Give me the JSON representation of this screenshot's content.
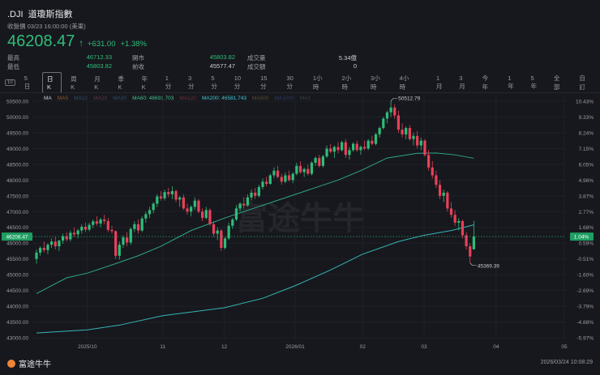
{
  "header": {
    "symbol": ".DJI",
    "name": "道瓊斯指數",
    "close_label": "收盤價 03/23 16:00:00 (美東)",
    "price": "46208.47",
    "change": "+631.00",
    "change_pct": "+1.38%"
  },
  "stats": [
    {
      "label": "最高",
      "value": "46712.33",
      "color": "green"
    },
    {
      "label": "開市",
      "value": "45803.82",
      "color": "green"
    },
    {
      "label": "成交量",
      "value": "5.34億",
      "color": "white"
    },
    {
      "label": "最低",
      "value": "45803.82",
      "color": "green"
    },
    {
      "label": "前收",
      "value": "45577.47",
      "color": "white"
    },
    {
      "label": "成交額",
      "value": "0",
      "color": "white"
    }
  ],
  "timeframes": [
    "5日",
    "日K",
    "周K",
    "月K",
    "季K",
    "年K",
    "1分",
    "3分",
    "5分",
    "10分",
    "15分",
    "30分",
    "1小時",
    "2小時",
    "3小時",
    "4小時"
  ],
  "ranges": [
    "1月",
    "3月",
    "今年",
    "1年",
    "5年",
    "全部",
    "自訂"
  ],
  "selected_timeframe": "日K",
  "legend": [
    {
      "label": "MA",
      "color": "#c9cbd1"
    },
    {
      "label": "MA5",
      "color": "#8a5a2e"
    },
    {
      "label": "MA10",
      "color": "#2d4f6e"
    },
    {
      "label": "MA20",
      "color": "#5a3548"
    },
    {
      "label": "MA30",
      "color": "#2d4c6a"
    },
    {
      "label": "MA60: 48691.703",
      "color": "#3fc08f"
    },
    {
      "label": "MA120",
      "color": "#6a2e3c"
    },
    {
      "label": "MA200: 46581.743",
      "color": "#3ec9d6"
    },
    {
      "label": "MA500",
      "color": "#5a4a2e"
    },
    {
      "label": "MA1000",
      "color": "#2e3a6a"
    },
    {
      "label": "MA1",
      "color": "#3a3d44"
    }
  ],
  "watermark": "富途牛牛",
  "footer": {
    "brand": "富途牛牛",
    "timestamp": "2026/03/24 10:08:29"
  },
  "colors": {
    "up": "#2ebd7a",
    "down": "#e8415a",
    "bg": "#17181d",
    "ma60": "#2fa58a",
    "ma200": "#35b5b5"
  },
  "chart_data": {
    "type": "candlestick",
    "ylim": [
      43000,
      50500
    ],
    "yticks": [
      "50500.00",
      "50000.00",
      "49500.00",
      "49000.00",
      "48500.00",
      "48000.00",
      "47500.00",
      "47000.00",
      "46500.00",
      "46000.00",
      "45500.00",
      "45000.00",
      "44500.00",
      "44000.00",
      "43500.00",
      "43000.00"
    ],
    "pct_ticks": [
      "10.43%",
      "9.33%",
      "8.24%",
      "7.15%",
      "6.05%",
      "4.96%",
      "3.87%",
      "2.77%",
      "1.68%",
      "0.59%",
      "-0.51%",
      "-1.60%",
      "-2.69%",
      "-3.79%",
      "-4.88%",
      "-5.97%"
    ],
    "xticks": [
      {
        "label": "2025/10",
        "index": 13.5
      },
      {
        "label": "11",
        "index": 33.5
      },
      {
        "label": "12",
        "index": 49.8
      },
      {
        "label": "2026/01",
        "index": 68.6
      },
      {
        "label": "02",
        "index": 86.5
      },
      {
        "label": "03",
        "index": 102.8
      },
      {
        "label": "04",
        "index": 121.9
      },
      {
        "label": "05",
        "index": 140
      }
    ],
    "last_price_label": "46208.47",
    "last_pct_label": "1.04%",
    "high_marker": {
      "label": "50512.79",
      "index": 94,
      "value": 50512.79
    },
    "low_marker": {
      "label": "45369.39",
      "index": 115,
      "value": 45369.39
    },
    "candles": [
      [
        45500,
        45800,
        45350,
        45700
      ],
      [
        45700,
        45900,
        45600,
        45850
      ],
      [
        45850,
        46050,
        45700,
        45780
      ],
      [
        45780,
        46000,
        45650,
        45950
      ],
      [
        45950,
        46150,
        45850,
        46050
      ],
      [
        46050,
        46200,
        45800,
        45900
      ],
      [
        45900,
        46100,
        45750,
        46080
      ],
      [
        46080,
        46300,
        45980,
        46220
      ],
      [
        46220,
        46350,
        46050,
        46120
      ],
      [
        46120,
        46400,
        46050,
        46330
      ],
      [
        46330,
        46500,
        46200,
        46280
      ],
      [
        46280,
        46450,
        46150,
        46400
      ],
      [
        46400,
        46600,
        46300,
        46520
      ],
      [
        46520,
        46650,
        46350,
        46430
      ],
      [
        46430,
        46650,
        46380,
        46580
      ],
      [
        46580,
        46750,
        46480,
        46690
      ],
      [
        46690,
        46850,
        46550,
        46620
      ],
      [
        46620,
        46800,
        46500,
        46750
      ],
      [
        46750,
        46900,
        46600,
        46700
      ],
      [
        46700,
        46800,
        46350,
        46420
      ],
      [
        46420,
        46550,
        46300,
        46380
      ],
      [
        46380,
        46400,
        45500,
        45600
      ],
      [
        45600,
        46050,
        45480,
        45950
      ],
      [
        45950,
        46250,
        45850,
        46180
      ],
      [
        46180,
        46350,
        45900,
        46020
      ],
      [
        46020,
        46500,
        45950,
        46450
      ],
      [
        46450,
        46700,
        46350,
        46600
      ],
      [
        46600,
        46750,
        46300,
        46400
      ],
      [
        46400,
        46850,
        46350,
        46780
      ],
      [
        46780,
        47000,
        46650,
        46920
      ],
      [
        46920,
        47150,
        46800,
        47050
      ],
      [
        47050,
        47300,
        46950,
        47250
      ],
      [
        47250,
        47550,
        47150,
        47480
      ],
      [
        47480,
        47650,
        47350,
        47420
      ],
      [
        47420,
        47700,
        47350,
        47620
      ],
      [
        47620,
        47750,
        47450,
        47550
      ],
      [
        47550,
        47800,
        47400,
        47650
      ],
      [
        47650,
        47700,
        47300,
        47380
      ],
      [
        47380,
        47500,
        47150,
        47450
      ],
      [
        47450,
        47550,
        47050,
        47100
      ],
      [
        47100,
        47250,
        46900,
        47000
      ],
      [
        47000,
        47200,
        46850,
        47150
      ],
      [
        47150,
        47450,
        47050,
        47350
      ],
      [
        47350,
        47400,
        46950,
        47000
      ],
      [
        47000,
        47100,
        46700,
        46800
      ],
      [
        46800,
        47150,
        46750,
        47050
      ],
      [
        47050,
        47100,
        46550,
        46600
      ],
      [
        46600,
        46700,
        46200,
        46300
      ],
      [
        46300,
        46500,
        46100,
        46400
      ],
      [
        46400,
        46450,
        45750,
        45850
      ],
      [
        45850,
        46200,
        45800,
        46150
      ],
      [
        46150,
        46650,
        46100,
        46550
      ],
      [
        46550,
        46800,
        46450,
        46750
      ],
      [
        46750,
        47200,
        46700,
        47100
      ],
      [
        47100,
        47300,
        47000,
        47250
      ],
      [
        47250,
        47450,
        47100,
        47200
      ],
      [
        47200,
        47550,
        47150,
        47450
      ],
      [
        47450,
        47700,
        47350,
        47600
      ],
      [
        47600,
        47750,
        47400,
        47500
      ],
      [
        47500,
        47850,
        47450,
        47780
      ],
      [
        47780,
        48050,
        47700,
        47950
      ],
      [
        47950,
        48100,
        47800,
        47880
      ],
      [
        47880,
        48200,
        47850,
        48150
      ],
      [
        48150,
        48400,
        48050,
        48300
      ],
      [
        48300,
        48450,
        48050,
        48100
      ],
      [
        48100,
        48200,
        47850,
        47950
      ],
      [
        47950,
        48250,
        47900,
        48150
      ],
      [
        48150,
        48300,
        47950,
        48000
      ],
      [
        48000,
        48250,
        47900,
        48200
      ],
      [
        48200,
        48550,
        48150,
        48450
      ],
      [
        48450,
        48600,
        48200,
        48250
      ],
      [
        48250,
        48400,
        48100,
        48350
      ],
      [
        48350,
        48500,
        48150,
        48200
      ],
      [
        48200,
        48600,
        48150,
        48550
      ],
      [
        48550,
        48750,
        48450,
        48700
      ],
      [
        48700,
        48800,
        48400,
        48450
      ],
      [
        48450,
        48800,
        48400,
        48750
      ],
      [
        48750,
        49100,
        48700,
        49000
      ],
      [
        49000,
        49150,
        48850,
        48900
      ],
      [
        48900,
        49100,
        48700,
        49050
      ],
      [
        49050,
        49200,
        48850,
        48950
      ],
      [
        48950,
        49250,
        48900,
        49200
      ],
      [
        49200,
        49300,
        48700,
        48800
      ],
      [
        48800,
        49050,
        48650,
        48950
      ],
      [
        48950,
        49200,
        48900,
        49150
      ],
      [
        49150,
        49250,
        48900,
        48950
      ],
      [
        48950,
        49100,
        48800,
        49050
      ],
      [
        49050,
        49250,
        48950,
        49000
      ],
      [
        49000,
        49300,
        48950,
        49250
      ],
      [
        49250,
        49400,
        49100,
        49150
      ],
      [
        49150,
        49500,
        49100,
        49450
      ],
      [
        49450,
        49700,
        49350,
        49650
      ],
      [
        49650,
        50000,
        49600,
        49950
      ],
      [
        49950,
        50200,
        49800,
        50150
      ],
      [
        50150,
        50512,
        50000,
        50300
      ],
      [
        50300,
        50400,
        49950,
        50050
      ],
      [
        50050,
        50200,
        49500,
        49600
      ],
      [
        49600,
        49800,
        49350,
        49450
      ],
      [
        49450,
        49700,
        49300,
        49650
      ],
      [
        49650,
        49750,
        49250,
        49300
      ],
      [
        49300,
        49500,
        49100,
        49400
      ],
      [
        49400,
        49550,
        49000,
        49100
      ],
      [
        49100,
        49350,
        48950,
        49250
      ],
      [
        49250,
        49300,
        48750,
        48800
      ],
      [
        48800,
        48950,
        48300,
        48400
      ],
      [
        48400,
        48600,
        48050,
        48150
      ],
      [
        48150,
        48300,
        47750,
        47850
      ],
      [
        47850,
        48000,
        47400,
        47500
      ],
      [
        47500,
        47700,
        47300,
        47600
      ],
      [
        47600,
        47650,
        47000,
        47100
      ],
      [
        47100,
        47300,
        46800,
        46900
      ],
      [
        46900,
        47050,
        46550,
        46650
      ],
      [
        46650,
        46800,
        46400,
        46700
      ],
      [
        46700,
        46750,
        46150,
        46250
      ],
      [
        46250,
        46350,
        45800,
        45900
      ],
      [
        45900,
        46000,
        45369,
        45577
      ],
      [
        45803,
        46712,
        45803,
        46208
      ]
    ],
    "ma60": [
      [
        0,
        44400
      ],
      [
        8,
        44900
      ],
      [
        13.5,
        45050
      ],
      [
        21,
        45350
      ],
      [
        27,
        45600
      ],
      [
        33,
        45900
      ],
      [
        41,
        46400
      ],
      [
        50,
        46800
      ],
      [
        60,
        47200
      ],
      [
        70,
        47600
      ],
      [
        80,
        48000
      ],
      [
        86,
        48300
      ],
      [
        93,
        48700
      ],
      [
        101,
        48850
      ],
      [
        106,
        48860
      ],
      [
        111,
        48800
      ],
      [
        116,
        48691
      ]
    ],
    "ma200": [
      [
        0,
        43150
      ],
      [
        13.5,
        43250
      ],
      [
        22,
        43400
      ],
      [
        33.5,
        43700
      ],
      [
        49.8,
        43950
      ],
      [
        60,
        44250
      ],
      [
        68.6,
        44650
      ],
      [
        78,
        45150
      ],
      [
        86.5,
        45650
      ],
      [
        96,
        46050
      ],
      [
        102.8,
        46250
      ],
      [
        110,
        46400
      ],
      [
        116,
        46581
      ]
    ]
  }
}
